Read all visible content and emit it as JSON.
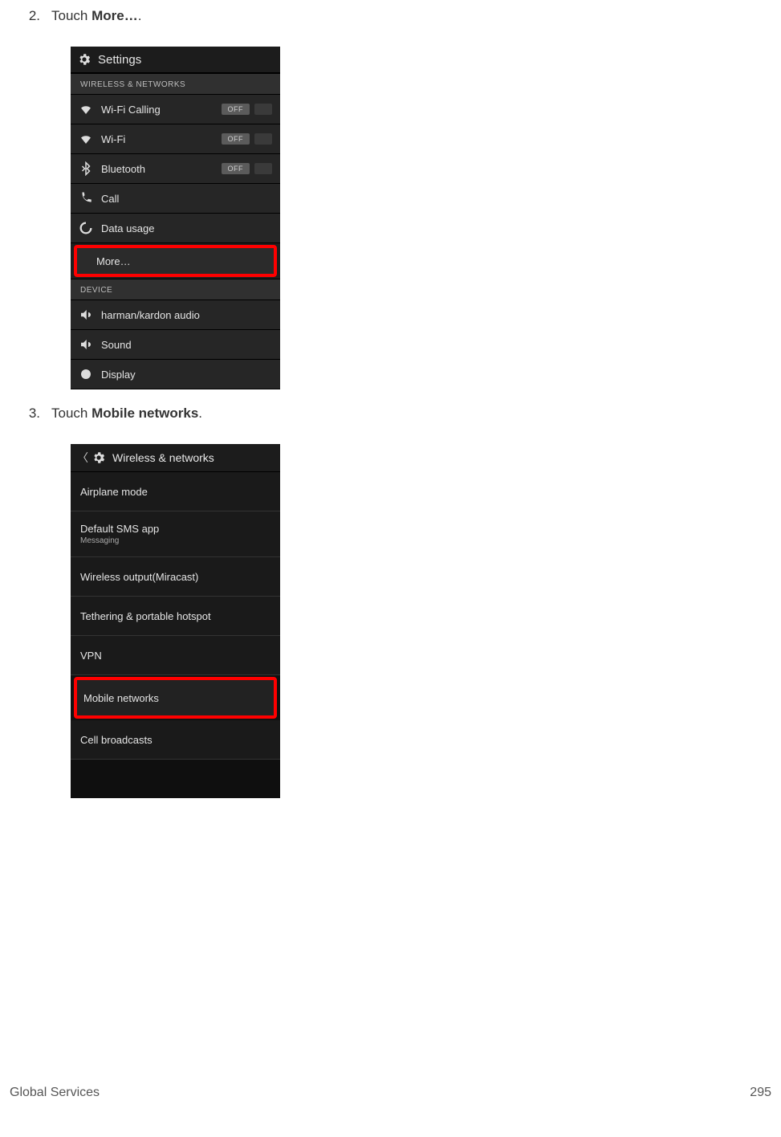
{
  "steps": {
    "s2": {
      "num": "2.",
      "prefix": "Touch ",
      "bold": "More…",
      "suffix": "."
    },
    "s3": {
      "num": "3.",
      "prefix": "Touch ",
      "bold": "Mobile networks",
      "suffix": "."
    }
  },
  "shot1": {
    "title": "Settings",
    "sections": {
      "wireless_hdr": "WIRELESS & NETWORKS",
      "device_hdr": "DEVICE"
    },
    "rows": {
      "wifi_calling": "Wi-Fi Calling",
      "wifi": "Wi-Fi",
      "bluetooth": "Bluetooth",
      "call": "Call",
      "data_usage": "Data usage",
      "more": "More…",
      "hk_audio": "harman/kardon audio",
      "sound": "Sound",
      "display": "Display"
    },
    "toggle_off": "OFF"
  },
  "shot2": {
    "title": "Wireless & networks",
    "rows": {
      "airplane": "Airplane mode",
      "default_sms": "Default SMS app",
      "default_sms_sub": "Messaging",
      "miracast": "Wireless output(Miracast)",
      "tether": "Tethering & portable hotspot",
      "vpn": "VPN",
      "mobile_networks": "Mobile networks",
      "cell_broadcasts": "Cell broadcasts"
    }
  },
  "footer": {
    "left": "Global Services",
    "right": "295"
  }
}
